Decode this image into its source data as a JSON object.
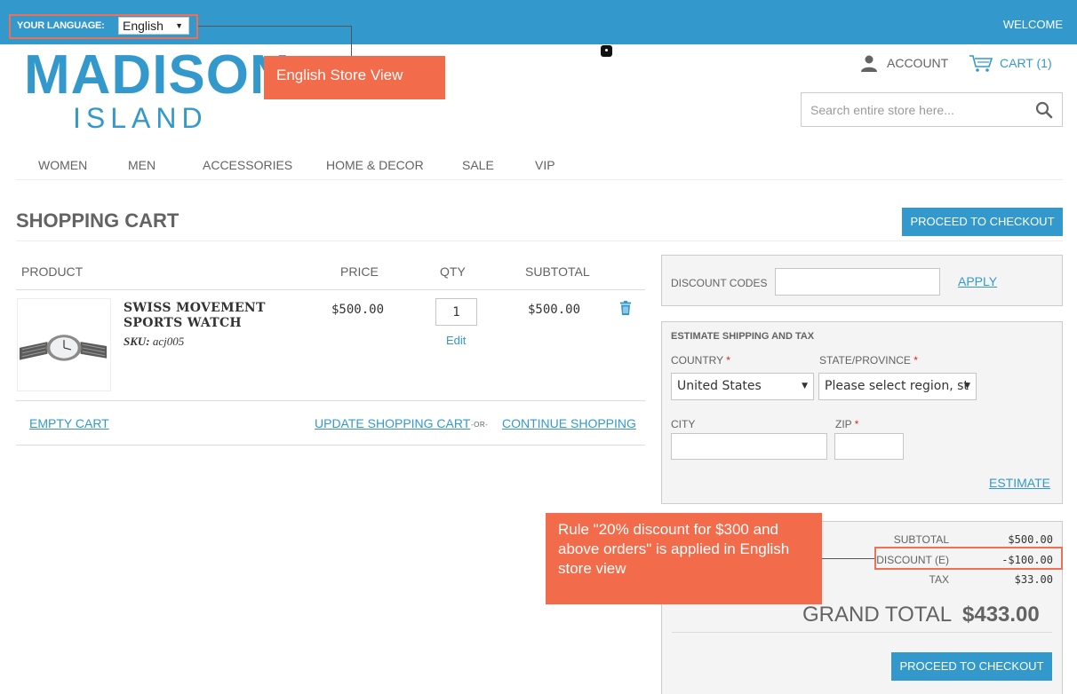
{
  "header": {
    "language_label": "YOUR LANGUAGE:",
    "language_value": "English",
    "welcome": "WELCOME",
    "account": "ACCOUNT",
    "cart": "CART (1)",
    "search_placeholder": "Search entire store here..."
  },
  "logo": {
    "main": "MADISON",
    "sub": "ISLAND"
  },
  "callouts": {
    "store_view": "English Store View",
    "rule": "Rule \"20% discount for $300 and above orders\" is applied in English store view"
  },
  "nav": [
    "WOMEN",
    "MEN",
    "ACCESSORIES",
    "HOME & DECOR",
    "SALE",
    "VIP"
  ],
  "page": {
    "title": "SHOPPING CART",
    "checkout": "PROCEED TO CHECKOUT"
  },
  "cart_table": {
    "headers": {
      "product": "PRODUCT",
      "price": "PRICE",
      "qty": "QTY",
      "subtotal": "SUBTOTAL"
    },
    "items": [
      {
        "name": "SWISS MOVEMENT SPORTS WATCH",
        "sku_label": "SKU:",
        "sku": "acj005",
        "price": "$500.00",
        "qty": "1",
        "edit": "Edit",
        "subtotal": "$500.00"
      }
    ],
    "empty_cart": "EMPTY CART",
    "update_cart": "UPDATE SHOPPING CART",
    "or": "-OR-",
    "continue_shopping": "CONTINUE SHOPPING"
  },
  "discount": {
    "label": "DISCOUNT CODES",
    "apply": "APPLY"
  },
  "shipping": {
    "title": "ESTIMATE SHIPPING AND TAX",
    "country_label": "COUNTRY",
    "country_value": "United States",
    "state_label": "STATE/PROVINCE",
    "state_value": "Please select region, st",
    "city_label": "CITY",
    "zip_label": "ZIP",
    "required_mark": "*",
    "estimate": "ESTIMATE"
  },
  "totals": {
    "subtotal_label": "SUBTOTAL",
    "subtotal": "$500.00",
    "discount_label": "DISCOUNT (E)",
    "discount": "-$100.00",
    "tax_label": "TAX",
    "tax": "$33.00",
    "grand_label": "GRAND TOTAL",
    "grand": "$433.00"
  },
  "colors": {
    "brand": "#3399cc",
    "callout": "#f26b4a",
    "text": "#636363"
  }
}
